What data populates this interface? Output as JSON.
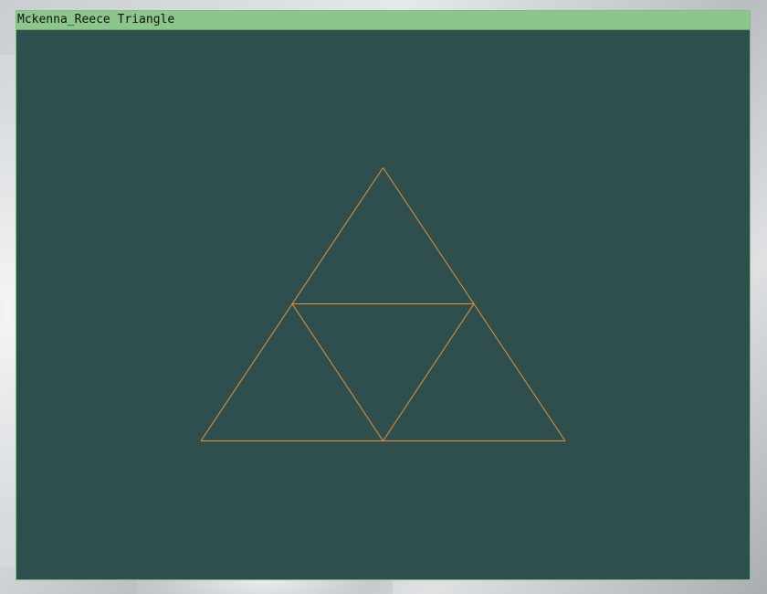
{
  "window": {
    "title": "Mckenna_Reece Triangle",
    "titlebar_color": "#8cc68c",
    "canvas_color": "#2f4f4f"
  },
  "drawing": {
    "shape": "sierpinski-triangle-level-1",
    "stroke_color": "#e8913a",
    "triangle_count": 3
  }
}
